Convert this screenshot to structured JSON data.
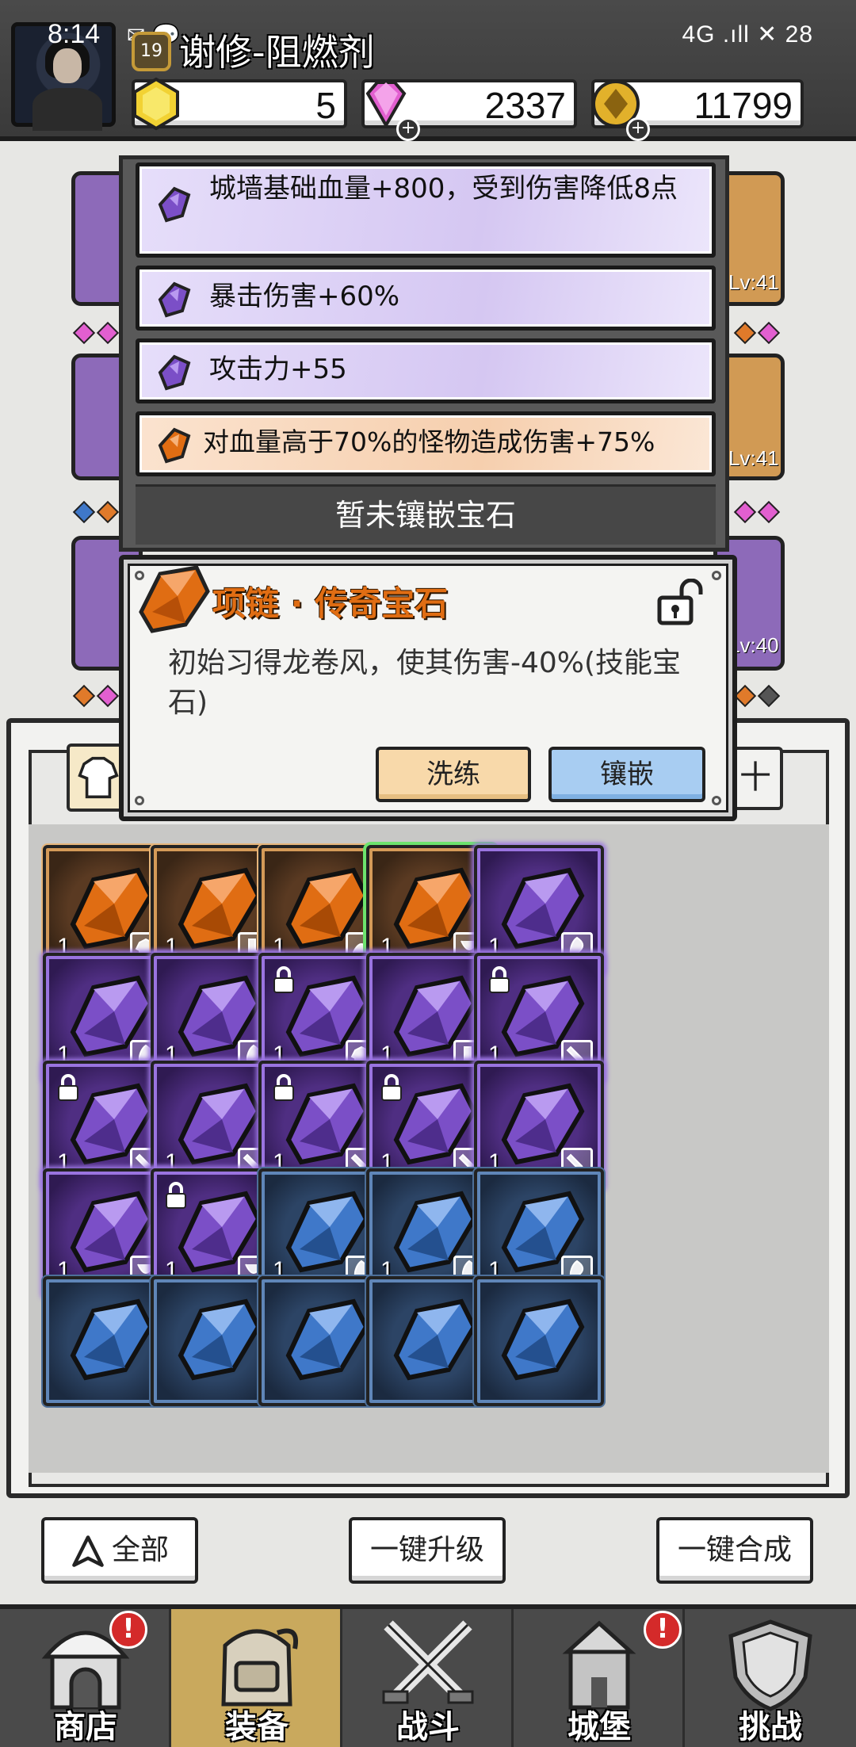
{
  "status_bar": {
    "time": "8:14",
    "left_icons": "✉ 💬",
    "right": "4G .ıll ✕ 28"
  },
  "player": {
    "level": "19",
    "name": "谢修-阻燃剂"
  },
  "currencies": [
    {
      "name": "yellow-gem",
      "value": "5",
      "color": "#f2d233"
    },
    {
      "name": "diamond",
      "value": "2337",
      "color": "#e25fd0"
    },
    {
      "name": "gold-coin",
      "value": "11799",
      "color": "#e2b12b"
    }
  ],
  "hero_levels": [
    "Lv:41",
    "Lv:41",
    "Lv:40"
  ],
  "attributes": [
    {
      "text": "城墙基础血量+800，受到伤害降低8点",
      "quality": "purple"
    },
    {
      "text": "暴击伤害+60%",
      "quality": "purple"
    },
    {
      "text": "攻击力+55",
      "quality": "purple"
    },
    {
      "text": "对血量高于70%的怪物造成伤害+75%",
      "quality": "orange"
    }
  ],
  "no_gem_text": "暂未镶嵌宝石",
  "gem_popup": {
    "title": "项链 · 传奇宝石",
    "description": "初始习得龙卷风，使其伤害-40%(技能宝石)",
    "refine_label": "洗练",
    "inlay_label": "镶嵌"
  },
  "inventory": {
    "tab_right_label": "十",
    "slots": [
      {
        "quality": "orange",
        "count": "1",
        "type": "armor",
        "locked": false,
        "selected": false
      },
      {
        "quality": "orange",
        "count": "1",
        "type": "boots",
        "locked": false,
        "selected": false
      },
      {
        "quality": "orange",
        "count": "1",
        "type": "helmet",
        "locked": false,
        "selected": false
      },
      {
        "quality": "orange",
        "count": "1",
        "type": "necklace",
        "locked": false,
        "selected": true
      },
      {
        "quality": "purple",
        "count": "1",
        "type": "skill",
        "locked": false,
        "selected": false
      },
      {
        "quality": "purple",
        "count": "1",
        "type": "skill",
        "locked": false,
        "selected": false
      },
      {
        "quality": "purple",
        "count": "1",
        "type": "skill",
        "locked": false,
        "selected": false
      },
      {
        "quality": "purple",
        "count": "1",
        "type": "armor",
        "locked": true,
        "selected": false
      },
      {
        "quality": "purple",
        "count": "1",
        "type": "boots",
        "locked": false,
        "selected": false
      },
      {
        "quality": "purple",
        "count": "1",
        "type": "weapon",
        "locked": true,
        "selected": false
      },
      {
        "quality": "purple",
        "count": "1",
        "type": "weapon",
        "locked": true,
        "selected": false
      },
      {
        "quality": "purple",
        "count": "1",
        "type": "weapon",
        "locked": false,
        "selected": false
      },
      {
        "quality": "purple",
        "count": "1",
        "type": "weapon",
        "locked": true,
        "selected": false
      },
      {
        "quality": "purple",
        "count": "1",
        "type": "weapon",
        "locked": true,
        "selected": false
      },
      {
        "quality": "purple",
        "count": "1",
        "type": "weapon",
        "locked": false,
        "selected": false
      },
      {
        "quality": "purple",
        "count": "1",
        "type": "necklace",
        "locked": false,
        "selected": false
      },
      {
        "quality": "purple",
        "count": "1",
        "type": "necklace",
        "locked": true,
        "selected": false
      },
      {
        "quality": "blue",
        "count": "1",
        "type": "skill",
        "locked": false,
        "selected": false
      },
      {
        "quality": "blue",
        "count": "1",
        "type": "skill",
        "locked": false,
        "selected": false
      },
      {
        "quality": "blue",
        "count": "1",
        "type": "skill",
        "locked": false,
        "selected": false
      },
      {
        "quality": "blue",
        "count": "",
        "type": "",
        "locked": false,
        "selected": false
      },
      {
        "quality": "blue",
        "count": "",
        "type": "",
        "locked": false,
        "selected": false
      },
      {
        "quality": "blue",
        "count": "",
        "type": "",
        "locked": false,
        "selected": false
      },
      {
        "quality": "blue",
        "count": "",
        "type": "",
        "locked": false,
        "selected": false
      },
      {
        "quality": "blue",
        "count": "",
        "type": "",
        "locked": false,
        "selected": false
      }
    ]
  },
  "bottom_buttons": {
    "all_label": "全部",
    "upgrade_label": "一键升级",
    "merge_label": "一键合成"
  },
  "nav": [
    {
      "label": "商店",
      "alert": "!",
      "active": false
    },
    {
      "label": "装备",
      "alert": "",
      "active": true
    },
    {
      "label": "战斗",
      "alert": "",
      "active": false
    },
    {
      "label": "城堡",
      "alert": "!",
      "active": false
    },
    {
      "label": "挑战",
      "alert": "",
      "active": false
    }
  ],
  "colors": {
    "orange_quality": "#e06d13",
    "purple_quality": "#8d5fd6",
    "blue_quality": "#3f78c9",
    "selected_outline": "#6de36d"
  }
}
